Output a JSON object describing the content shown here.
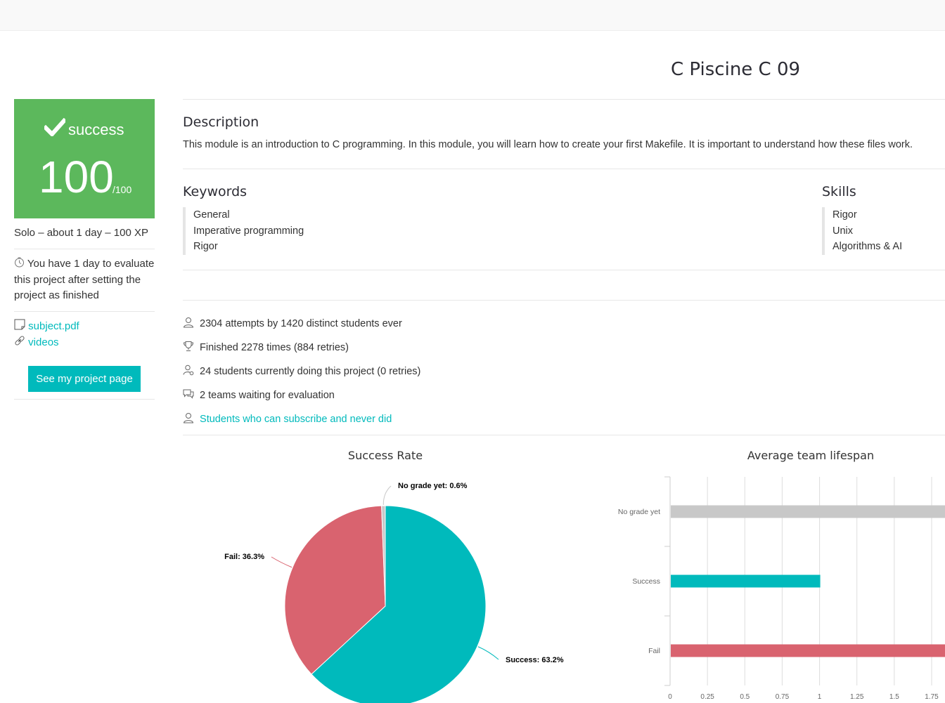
{
  "project": {
    "title": "C Piscine C 09"
  },
  "result": {
    "status": "success",
    "grade": "100",
    "max": "/100",
    "color": "#5cb85c"
  },
  "info": {
    "meta": "Solo – about 1 day – 100 XP",
    "evaluate_notice": "You have 1 day to evaluate this project after setting the project as finished",
    "links": [
      {
        "icon": "file-icon",
        "label": "subject.pdf"
      },
      {
        "icon": "link-icon",
        "label": "videos"
      }
    ],
    "project_page_button": "See my project page"
  },
  "description": {
    "heading": "Description",
    "text": "This module is an introduction to C programming. In this module, you will learn how to create your first Makefile. It is important to understand how these files work."
  },
  "keywords": {
    "heading": "Keywords",
    "items": [
      "General",
      "Imperative programming",
      "Rigor"
    ]
  },
  "skills": {
    "heading": "Skills",
    "items": [
      "Rigor",
      "Unix",
      "Algorithms & AI"
    ]
  },
  "stats": [
    {
      "icon": "user-icon",
      "text": "2304 attempts by 1420 distinct students ever",
      "link": false
    },
    {
      "icon": "trophy-icon",
      "text": "Finished 2278 times (884 retries)",
      "link": false
    },
    {
      "icon": "user-gear-icon",
      "text": "24 students currently doing this project (0 retries)",
      "link": false
    },
    {
      "icon": "speech-bubbles-icon",
      "text": "2 teams waiting for evaluation",
      "link": false
    },
    {
      "icon": "user-icon",
      "text": "Students who can subscribe and never did",
      "link": true
    }
  ],
  "accent_color": "#00babc",
  "chart_data": [
    {
      "type": "pie",
      "title": "Success Rate",
      "slices": [
        {
          "label": "Success",
          "value": 63.2,
          "color": "#00babc",
          "data_label": "Success: 63.2%"
        },
        {
          "label": "Fail",
          "value": 36.3,
          "color": "#d9636f",
          "data_label": "Fail: 36.3%"
        },
        {
          "label": "No grade yet",
          "value": 0.6,
          "color": "#c8c8c8",
          "data_label": "No grade yet: 0.6%"
        }
      ]
    },
    {
      "type": "bar",
      "orientation": "horizontal",
      "title": "Average team lifespan",
      "categories": [
        "No grade yet",
        "Success",
        "Fail"
      ],
      "values": [
        2.0,
        1.0,
        2.0
      ],
      "colors": [
        "#c8c8c8",
        "#00babc",
        "#d9636f"
      ],
      "x_ticks": [
        "0",
        "0.25",
        "0.5",
        "0.75",
        "1",
        "1.25",
        "1.5",
        "1.75"
      ],
      "xlim": [
        0,
        1.75
      ],
      "grid": true
    }
  ]
}
